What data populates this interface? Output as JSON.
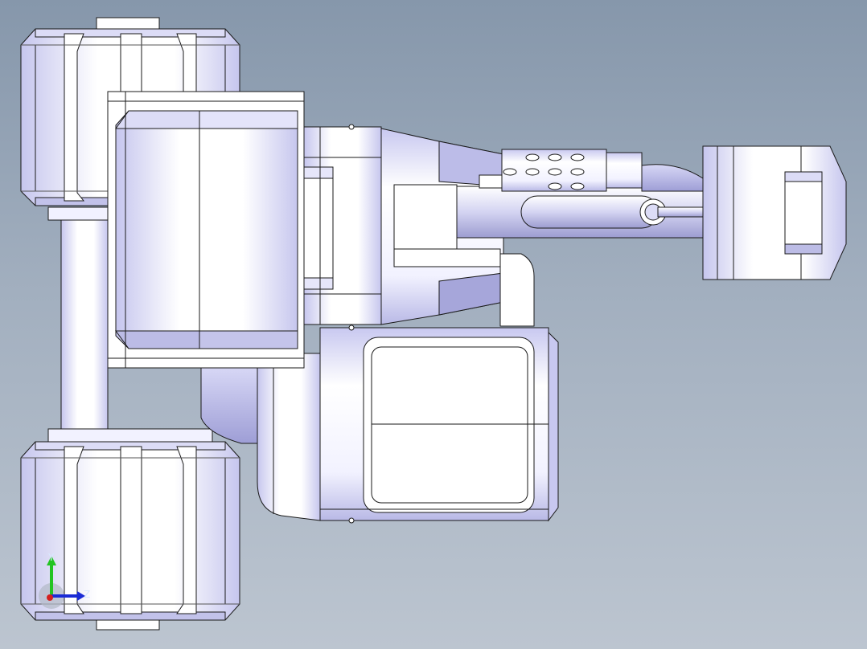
{
  "viewport": {
    "background_top": "#8697ab",
    "background_bottom": "#bcc5d0",
    "part_face_color": "#ffffff",
    "part_shade_color": "#c9c9f0",
    "edge_color": "#1a1a1a"
  },
  "triad": {
    "y_label": "Y",
    "z_label": "Z",
    "y_color": "#22c422",
    "z_color": "#1a2bd6",
    "x_color": "#d41f1f"
  }
}
